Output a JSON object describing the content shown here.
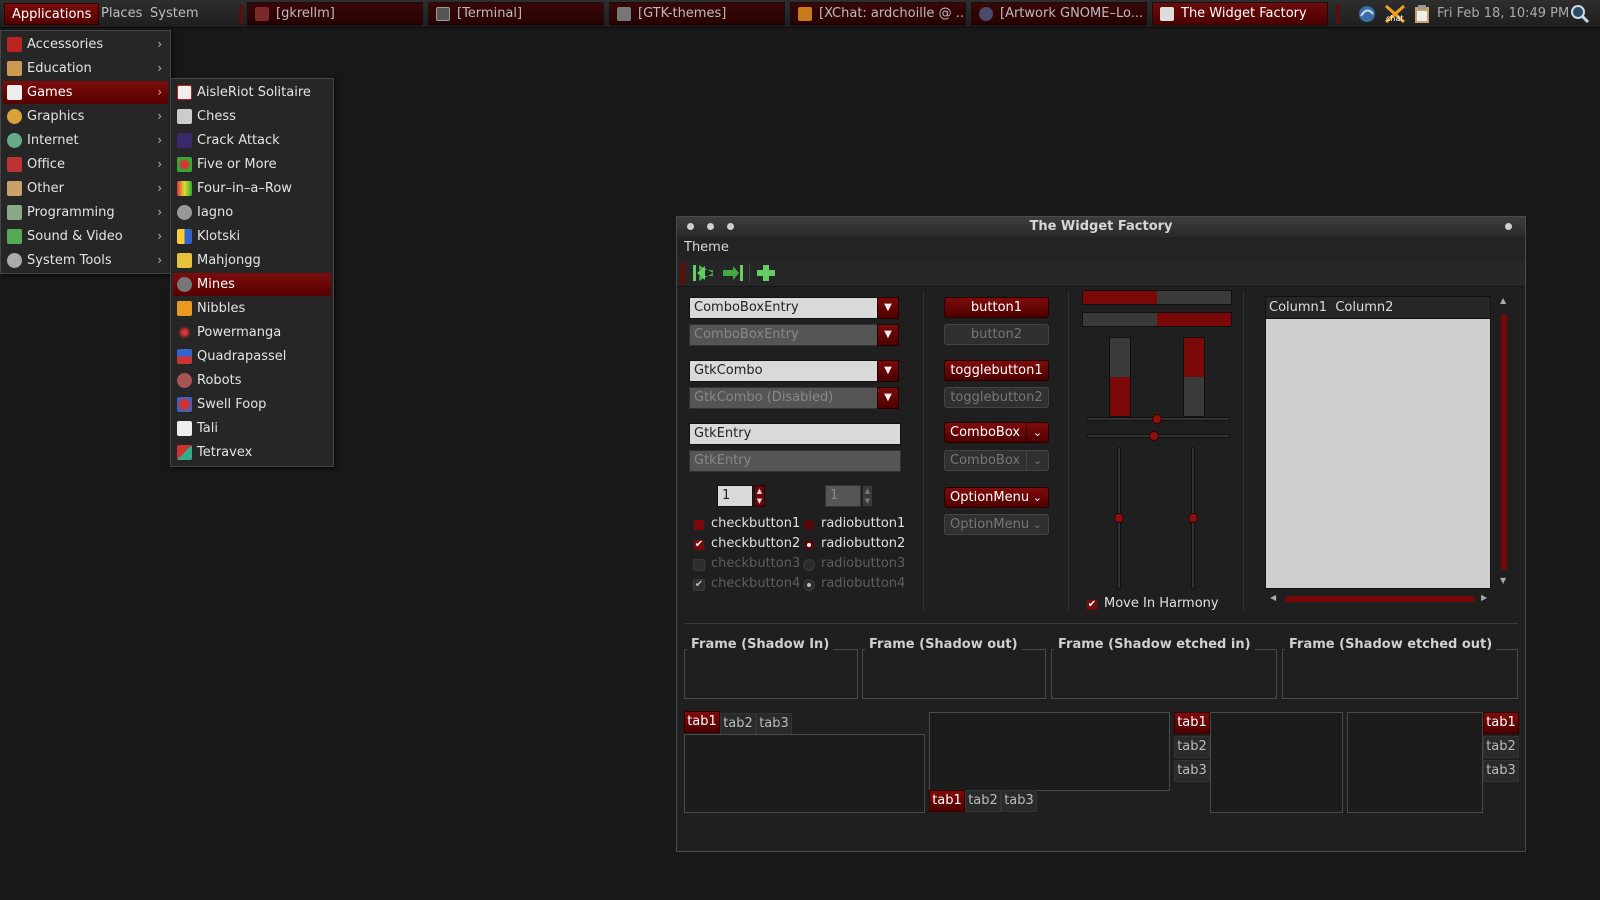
{
  "panel": {
    "menus": [
      "Applications",
      "Places",
      "System"
    ],
    "tasks": [
      "[gkrellm]",
      "[Terminal]",
      "[GTK-themes]",
      "[XChat: ardchoille @ ...",
      "[Artwork GNOME–Lo...",
      "The Widget Factory"
    ],
    "clock": "Fri Feb 18, 10:49 PM",
    "tray_icons": [
      "network-icon",
      "xchat-icon",
      "clipboard-icon"
    ],
    "search_icon": "magnifier-icon"
  },
  "apps_menu": {
    "items": [
      "Accessories",
      "Education",
      "Games",
      "Graphics",
      "Internet",
      "Office",
      "Other",
      "Programming",
      "Sound & Video",
      "System Tools"
    ],
    "selected": "Games"
  },
  "games_menu": {
    "items": [
      "AisleRiot Solitaire",
      "Chess",
      "Crack Attack",
      "Five or More",
      "Four–in–a–Row",
      "Iagno",
      "Klotski",
      "Mahjongg",
      "Mines",
      "Nibbles",
      "Powermanga",
      "Quadrapassel",
      "Robots",
      "Swell Foop",
      "Tali",
      "Tetravex"
    ],
    "selected": "Mines"
  },
  "window": {
    "title": "The Widget Factory",
    "menubar": [
      "Theme"
    ],
    "toolbar": [
      "first-icon",
      "last-icon",
      "add-icon"
    ],
    "combos": {
      "entry1": "ComboBoxEntry",
      "entry2": "ComboBoxEntry",
      "gtkcombo1": "GtkCombo",
      "gtkcombo2": "GtkCombo (Disabled)",
      "gtkentry1": "GtkEntry",
      "gtkentry2": "GtkEntry",
      "spin1": "1",
      "spin2": "1"
    },
    "checks": [
      "checkbutton1",
      "checkbutton2",
      "checkbutton3",
      "checkbutton4"
    ],
    "radios": [
      "radiobutton1",
      "radiobutton2",
      "radiobutton3",
      "radiobutton4"
    ],
    "buttons": {
      "button1": "button1",
      "button2": "button2",
      "toggle1": "togglebutton1",
      "toggle2": "togglebutton2",
      "combobox1": "ComboBox",
      "combobox2": "ComboBox",
      "option1": "OptionMenu",
      "option2": "OptionMenu"
    },
    "progress": {
      "h1": 0.5,
      "h2": 0.5,
      "v1": 0.5,
      "v2": 0.5
    },
    "move_harmony": "Move In Harmony",
    "tree": {
      "columns": [
        "Column1",
        "Column2"
      ]
    },
    "frames": [
      "Frame (Shadow In)",
      "Frame (Shadow out)",
      "Frame (Shadow etched in)",
      "Frame (Shadow etched out)"
    ],
    "tabs": [
      "tab1",
      "tab2",
      "tab3"
    ]
  }
}
